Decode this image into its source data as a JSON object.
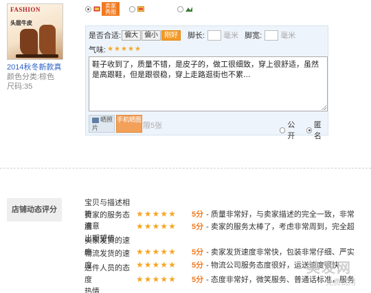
{
  "product": {
    "thumb_brand": "FASHION",
    "thumb_tag": "头层牛皮",
    "title": "2014秋冬新款真",
    "color_label": "颜色分类:棕色",
    "size_label": "尺码:35"
  },
  "image_types": {
    "badge_line1": "卖家",
    "badge_line2": "秀图",
    "icons": [
      "red-image-icon",
      "gallery-icon",
      "mountain-photo-icon"
    ]
  },
  "review": {
    "fit_label": "是否合适:",
    "fit_options": [
      "偏大",
      "偏小",
      "刚好"
    ],
    "fit_selected": "刚好",
    "foot_length_label": "脚长:",
    "foot_width_label": "脚宽:",
    "unit": "毫米",
    "smell_label": "气味:",
    "smell_stars": 5,
    "comment": "鞋子收到了，质量不错，是皮子的，做工很细致，穿上很舒适，虽然是高跟鞋，但是跟很稳，穿上走路逛街也不累...",
    "photo_button": "晒照片",
    "mobile_photo_button": "手机晒图",
    "limit_text": "限5张",
    "visibility_public": "公开",
    "visibility_anonymous": "匿名",
    "visibility_selected": "anonymous"
  },
  "shop_ratings": {
    "label": "店铺动态评分",
    "rows": [
      {
        "label": "宝贝与描述相符",
        "stars": 5,
        "score": "5分",
        "desc": "- 质量非常好，与卖家描述的完全一致，非常满意"
      },
      {
        "label": "卖家的服务态度",
        "stars": 5,
        "score": "5分",
        "desc": "- 卖家的服务太棒了，考虑非常周到，完全超出期望值"
      },
      {
        "label": "卖家发货的速度",
        "stars": 5,
        "score": "5分",
        "desc": "- 卖家发货速度非常快，包装非常仔细、严实"
      },
      {
        "label": "物流发货的速度",
        "stars": 5,
        "score": "5分",
        "desc": "- 物流公司服务态度很好，运送速度很快"
      },
      {
        "label": "送件人员的态度",
        "stars": 5,
        "score": "5分",
        "desc": "- 态度非常好，微笑服务、普通话标准，服务热情"
      }
    ]
  },
  "watermark": {
    "main": "美发网",
    "sub": "免费试用"
  },
  "colors": {
    "accent": "#f07a21",
    "link": "#2a5ec7",
    "star": "#f5a623",
    "panel_bg": "#eef4fb"
  }
}
